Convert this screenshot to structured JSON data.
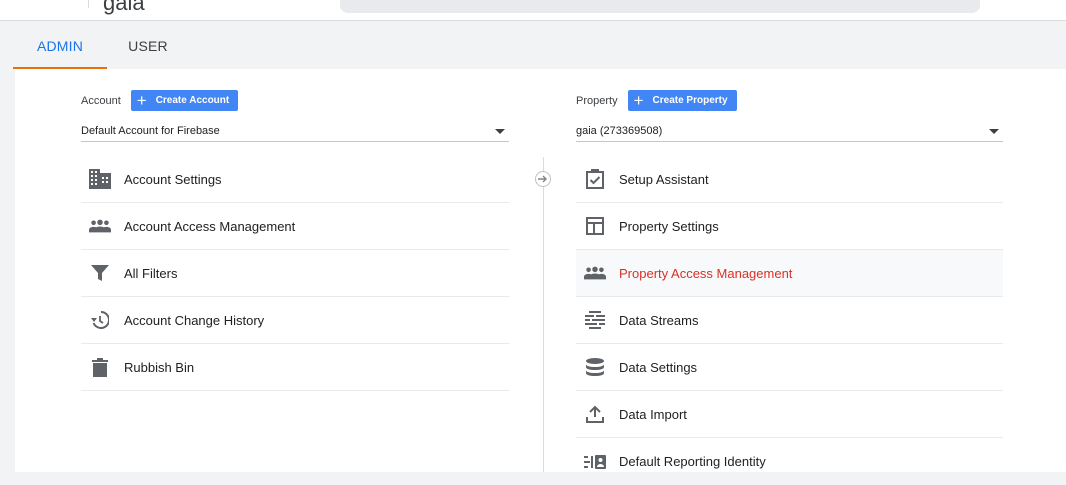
{
  "header": {
    "app_name": "gaia"
  },
  "tabs": [
    {
      "label": "ADMIN",
      "active": true
    },
    {
      "label": "USER",
      "active": false
    }
  ],
  "account": {
    "label": "Account",
    "create_label": "Create Account",
    "selected": "Default Account for Firebase",
    "items": [
      {
        "label": "Account Settings",
        "icon": "building-icon"
      },
      {
        "label": "Account Access Management",
        "icon": "people-icon"
      },
      {
        "label": "All Filters",
        "icon": "filter-icon"
      },
      {
        "label": "Account Change History",
        "icon": "history-icon"
      },
      {
        "label": "Rubbish Bin",
        "icon": "trash-icon"
      }
    ]
  },
  "property": {
    "label": "Property",
    "create_label": "Create Property",
    "selected": "gaia (273369508)",
    "items": [
      {
        "label": "Setup Assistant",
        "icon": "checkbox-icon"
      },
      {
        "label": "Property Settings",
        "icon": "layout-icon"
      },
      {
        "label": "Property Access Management",
        "icon": "people-icon",
        "active": true
      },
      {
        "label": "Data Streams",
        "icon": "streams-icon"
      },
      {
        "label": "Data Settings",
        "icon": "database-icon"
      },
      {
        "label": "Data Import",
        "icon": "upload-icon"
      },
      {
        "label": "Default Reporting Identity",
        "icon": "identity-icon"
      }
    ]
  },
  "colors": {
    "accent_blue": "#1a73e8",
    "button_blue": "#4285f4",
    "tab_underline": "#e8710a",
    "active_item": "#d93025",
    "icon_gray": "#5f6368"
  }
}
